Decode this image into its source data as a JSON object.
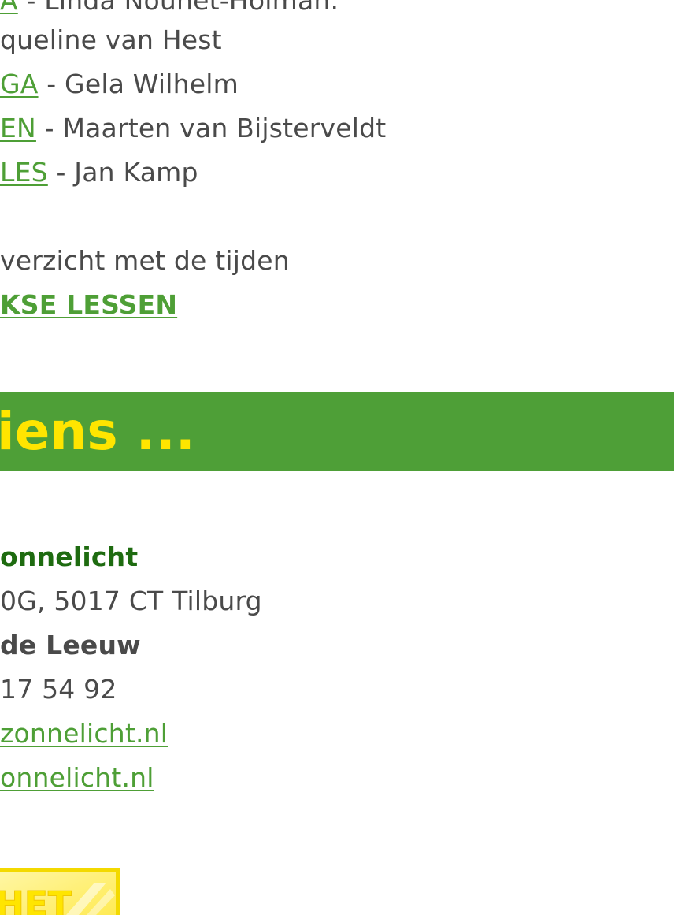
{
  "classes": [
    {
      "link": "A",
      "sep": " - ",
      "teacher": "Linda Nouhet-Holman."
    },
    {
      "link": "",
      "sep": "",
      "teacher": "queline van Hest"
    },
    {
      "link": "GA",
      "sep": " - ",
      "teacher": "Gela Wilhelm"
    },
    {
      "link": "EN",
      "sep": " - ",
      "teacher": "Maarten van Bijsterveldt"
    },
    {
      "link": "LES",
      "sep": " - ",
      "teacher": "Jan Kamp"
    }
  ],
  "schedule": {
    "intro": "verzicht met de tijden",
    "link": "KSE LESSEN"
  },
  "banner": {
    "title": "iens ..."
  },
  "contact": {
    "name": "onnelicht",
    "address": "0G, 5017 CT Tilburg",
    "person": "de Leeuw",
    "phone": "17 54 92",
    "email": "zonnelicht.nl",
    "website": "onnelicht.nl"
  },
  "logo": {
    "text": "HET",
    "colors": {
      "yellow": "#ffe500",
      "border": "#f3d900"
    }
  },
  "colors": {
    "green": "#4e9f37",
    "dark_green": "#1e6b10",
    "yellow": "#ffe500",
    "text": "#4a4a4a"
  }
}
